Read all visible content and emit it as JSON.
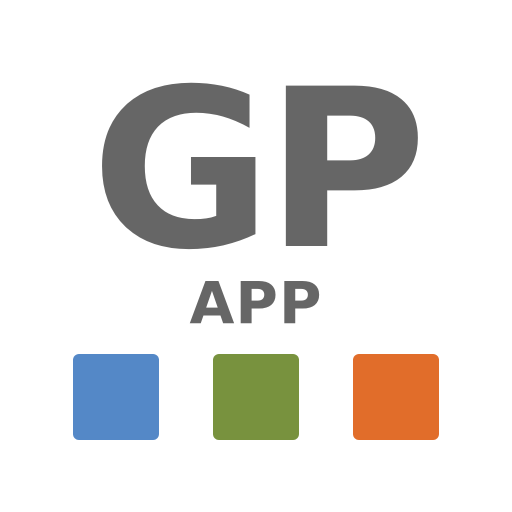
{
  "logo": {
    "title": "GP",
    "subtitle": "APP",
    "text_color": "#666666"
  },
  "squares": [
    {
      "color": "#5488C7"
    },
    {
      "color": "#78923E"
    },
    {
      "color": "#E16D2A"
    }
  ]
}
